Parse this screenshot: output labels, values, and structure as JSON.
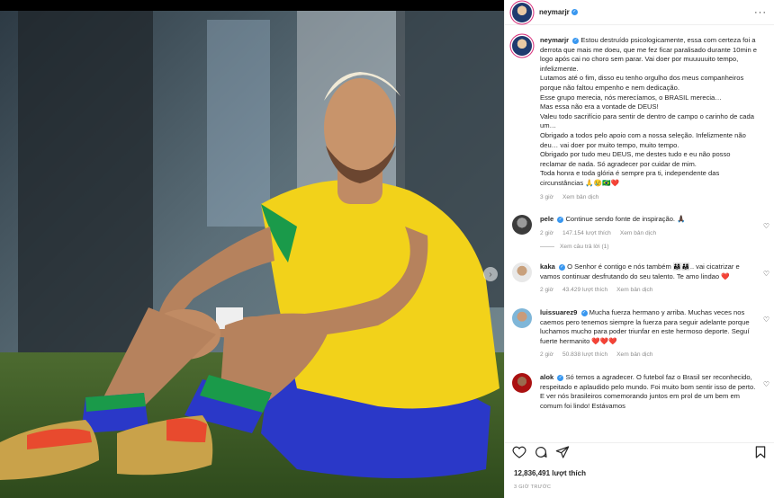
{
  "post": {
    "author": "neymarjr",
    "next_icon": "chevron-right-icon"
  },
  "caption": {
    "author": "neymarjr",
    "text": "Estou destruído psicologicamente, essa com certeza foi a derrota que mais me doeu, que me fez ficar paralisado durante 10min e logo após cai no choro sem parar. Vai doer por muuuuuito tempo, infelizmente.\nLutamos até o fim, disso eu tenho orgulho dos meus companheiros porque não faltou empenho e nem dedicação.\nEsse grupo merecia, nós merecíamos, o BRASIL merecia…\nMas essa não era a vontade de DEUS!\nValeu todo sacrifício para sentir de dentro de campo o carinho de cada um…\nObrigado a todos pelo apoio com a nossa seleção. Infelizmente não deu… vai doer por muito tempo, muito tempo.\nObrigado por tudo meu DEUS, me destes tudo e eu não posso reclamar de nada. Só agradecer por cuidar de mim.\nToda honra e toda glória é sempre pra ti, independente das circunstâncias 🙏😢🇧🇷❤️",
    "time": "3 giờ",
    "translate": "Xem bản dịch"
  },
  "comments": [
    {
      "user": "pele",
      "text": "Continue sendo fonte de inspiração. 🙏🏿",
      "time": "2 giờ",
      "likes": "147.154 lượt thích",
      "translate": "Xem bản dịch",
      "replies": "Xem câu trả lời (1)"
    },
    {
      "user": "kaka",
      "text": "O Senhor é contigo e nós também 👨‍👩‍👧👨‍👩‍👧.. vai cicatrizar e vamos continuar desfrutando do seu talento. Te amo lindao ❤️",
      "time": "2 giờ",
      "likes": "43.429 lượt thích",
      "translate": "Xem bản dịch"
    },
    {
      "user": "luissuarez9",
      "text": "Mucha fuerza hermano y arriba. Muchas veces nos caemos pero tenemos siempre la fuerza para seguir adelante porque luchamos mucho para poder triunfar en este hermoso deporte. Seguí fuerte hermanito ❤️❤️❤️",
      "time": "2 giờ",
      "likes": "50.838 lượt thích",
      "translate": "Xem bản dịch"
    },
    {
      "user": "alok",
      "text": "Só temos a agradecer. O futebol faz o Brasil ser reconhecido, respeitado e aplaudido pelo mundo. Foi muito bom sentir isso de perto. E ver nós brasileiros comemorando juntos em prol de um bem em comum foi lindo! Estávamos",
      "time": "",
      "likes": "",
      "translate": ""
    }
  ],
  "actions": {
    "like_icon": "heart-icon",
    "comment_icon": "comment-icon",
    "share_icon": "share-icon",
    "save_icon": "bookmark-icon"
  },
  "likes_count": "12,836,491 lượt thích",
  "timestamp": "3 GIỜ TRƯỚC",
  "colors": {
    "verified": "#3897f0",
    "jersey": "#f2d21a",
    "shorts": "#2a38c8",
    "grass": "#3f5e2a"
  }
}
